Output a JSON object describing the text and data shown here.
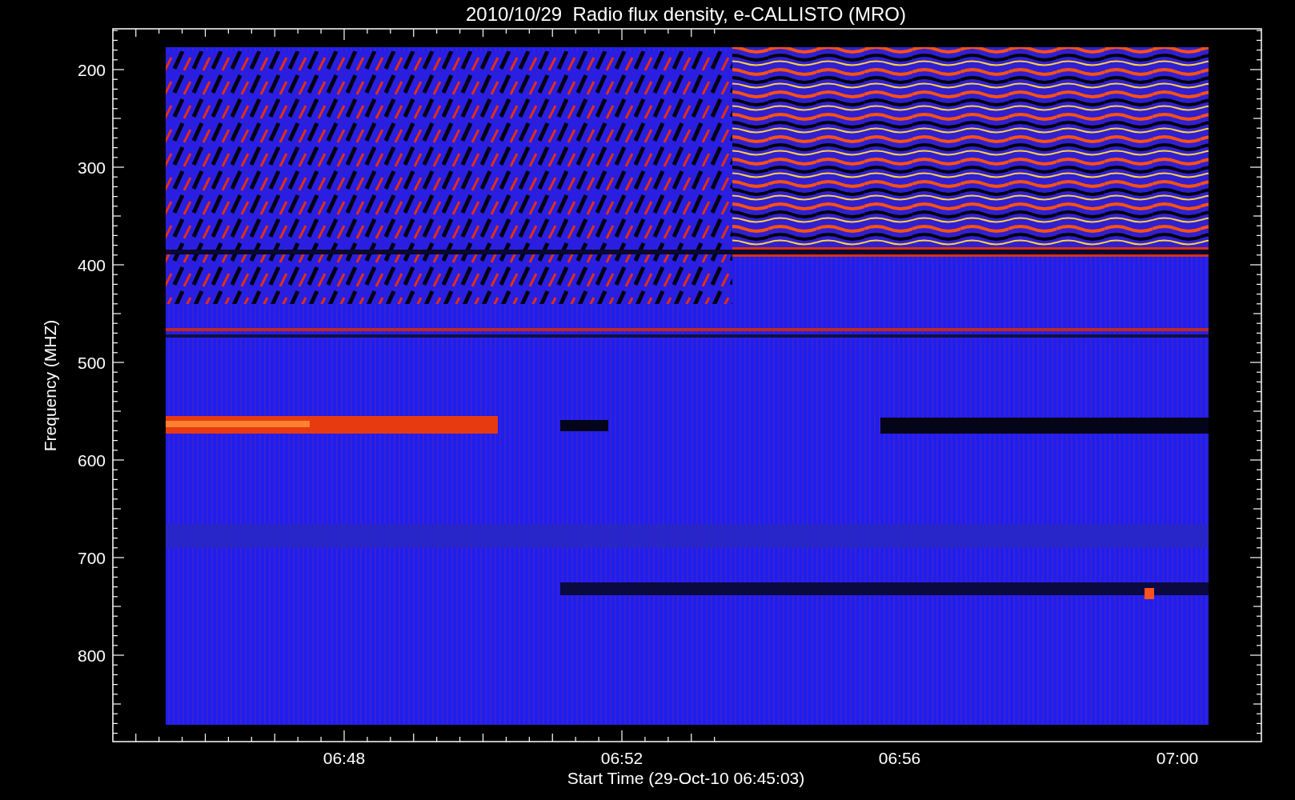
{
  "title": "2010/10/29  Radio flux density, e-CALLISTO (MRO)",
  "y_axis": {
    "label": "Frequency (MHZ)",
    "ticks": [
      "200",
      "300",
      "400",
      "500",
      "600",
      "700",
      "800"
    ]
  },
  "x_axis": {
    "label": "Start Time (29-Oct-10 06:45:03)",
    "ticks": [
      "06:48",
      "06:52",
      "06:56",
      "07:00"
    ]
  }
}
